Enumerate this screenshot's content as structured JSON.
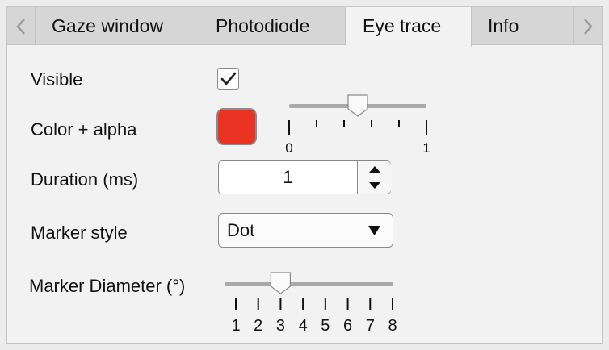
{
  "tabs": [
    {
      "label": "Gaze window",
      "selected": false
    },
    {
      "label": "Photodiode",
      "selected": false
    },
    {
      "label": "Eye trace",
      "selected": true
    },
    {
      "label": "Info",
      "selected": false
    }
  ],
  "icons": {
    "scroll_left": "chevron-left-icon",
    "scroll_right": "chevron-right-icon",
    "checkmark": "checkmark-icon",
    "spin_up": "triangle-up-icon",
    "spin_down": "triangle-down-icon",
    "dropdown": "triangle-down-icon"
  },
  "settings": {
    "visible": {
      "label": "Visible",
      "checked": true
    },
    "color_alpha": {
      "label": "Color + alpha",
      "color": "#ea3323",
      "alpha_value": 0.5,
      "alpha_min": 0,
      "alpha_max": 1,
      "min_label": "0",
      "max_label": "1"
    },
    "duration": {
      "label": "Duration (ms)",
      "value": "1"
    },
    "marker_style": {
      "label": "Marker style",
      "value": "Dot"
    },
    "marker_diameter": {
      "label": "Marker Diameter (°)",
      "value": 3,
      "min": 1,
      "max": 8,
      "tick_labels": [
        "1",
        "2",
        "3",
        "4",
        "5",
        "6",
        "7",
        "8"
      ]
    }
  }
}
